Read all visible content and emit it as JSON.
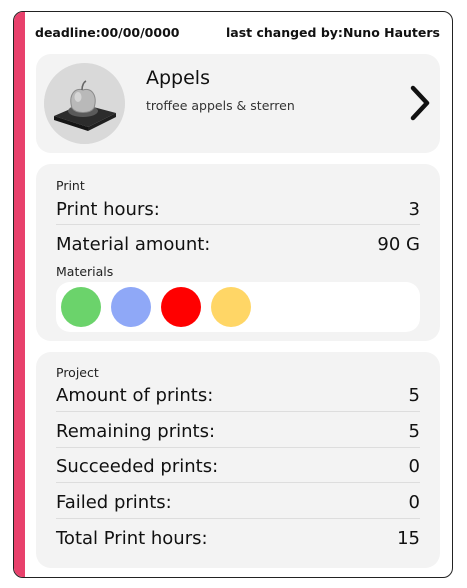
{
  "header": {
    "deadline_label": "deadline:",
    "deadline_value": "00/00/0000",
    "last_changed_label": "last changed by:",
    "last_changed_value": "Nuno Hauters"
  },
  "item": {
    "title": "Appels",
    "subtitle": "troffee appels & sterren",
    "thumbnail_icon": "3d-apple-model-icon",
    "open_icon": "chevron-right-icon"
  },
  "print": {
    "section_label": "Print",
    "print_hours_label": "Print hours:",
    "print_hours_value": "3",
    "material_amount_label": "Material amount:",
    "material_amount_value": "90 G",
    "materials_label": "Materials",
    "materials": [
      {
        "color": "#6bd36b"
      },
      {
        "color": "#8fa8f7"
      },
      {
        "color": "#ff0000"
      },
      {
        "color": "#ffd666"
      }
    ]
  },
  "project": {
    "section_label": "Project",
    "rows": [
      {
        "label": "Amount of prints:",
        "value": "5"
      },
      {
        "label": "Remaining prints:",
        "value": "5"
      },
      {
        "label": "Succeeded prints:",
        "value": "0"
      },
      {
        "label": "Failed prints:",
        "value": "0"
      },
      {
        "label": "Total Print hours:",
        "value": "15"
      }
    ]
  },
  "colors": {
    "accent": "#e8416c",
    "panel": "#f3f3f3"
  }
}
